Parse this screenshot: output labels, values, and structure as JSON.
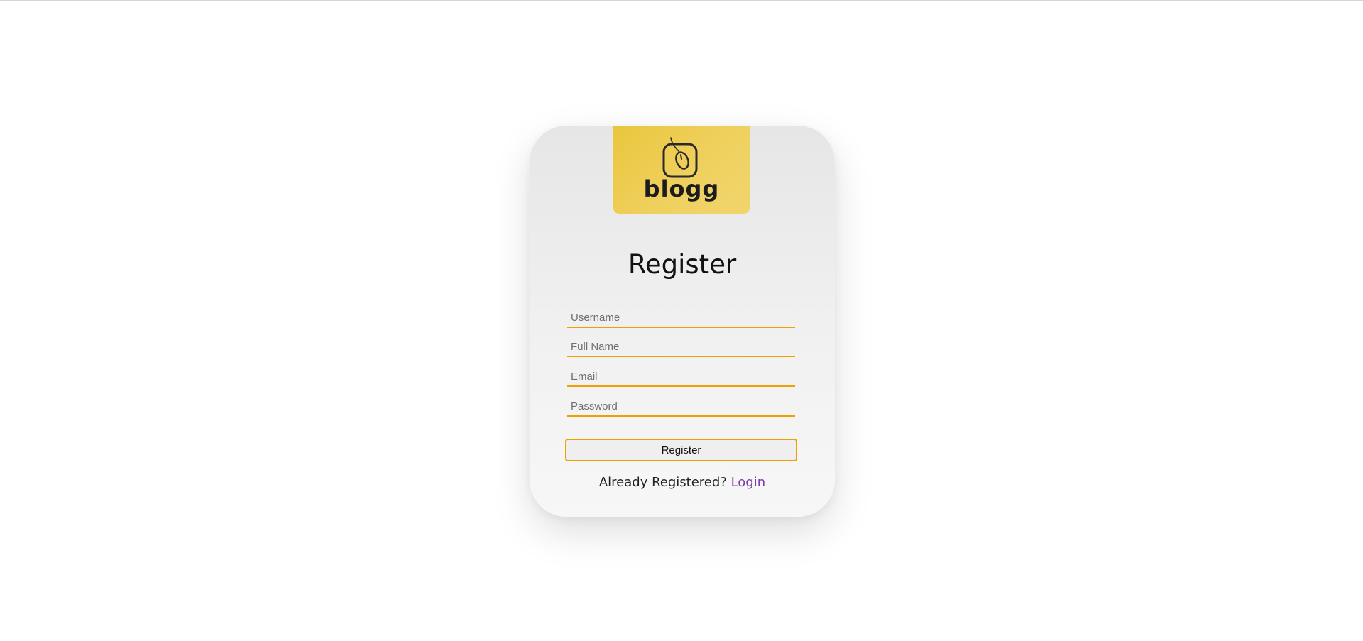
{
  "logo": {
    "wordmark": "blogg",
    "icon": "mouse-icon",
    "color": "#eac63d"
  },
  "form": {
    "title": "Register",
    "fields": {
      "username": {
        "placeholder": "Username",
        "value": ""
      },
      "full_name": {
        "placeholder": "Full Name",
        "value": ""
      },
      "email": {
        "placeholder": "Email",
        "value": ""
      },
      "password": {
        "placeholder": "Password",
        "value": ""
      }
    },
    "submit_label": "Register",
    "accent_color": "#f0a000"
  },
  "footer": {
    "prompt": "Already Registered?",
    "link_label": "Login",
    "link_color": "#7d3cab"
  }
}
